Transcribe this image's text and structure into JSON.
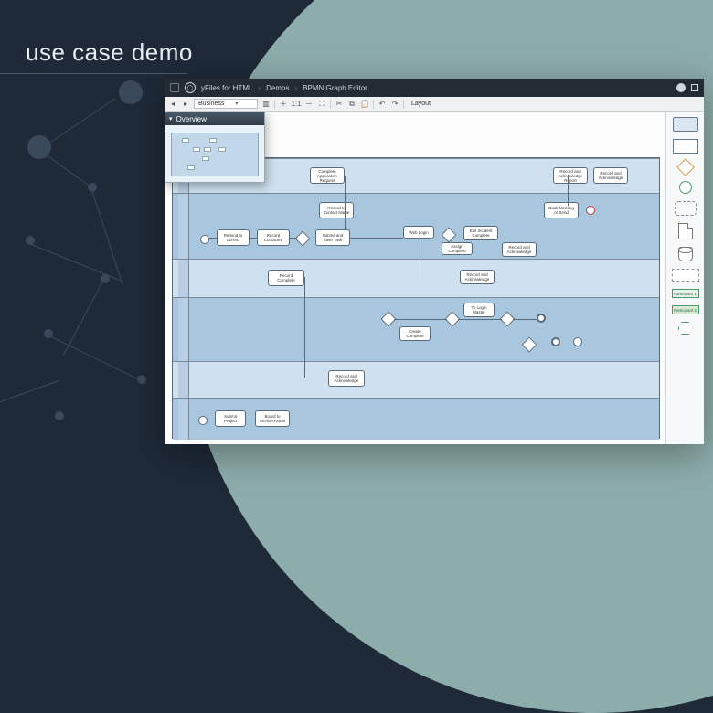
{
  "hero": {
    "title": "use case demo"
  },
  "titlebar": {
    "product": "yFiles for HTML",
    "crumb1": "Demos",
    "crumb2": "BPMN Graph Editor"
  },
  "toolbar": {
    "file_select": "Business",
    "layout_label": "Layout"
  },
  "overview": {
    "title": "Overview"
  },
  "palette": {
    "participant1": "Participant 1",
    "participant2": "Participant 2"
  },
  "tasks": {
    "t1": "Complete Application Request",
    "t2": "Record and Acknowledge Report",
    "t3": "Record and Acknowledge",
    "t4": "Book Meeting or Send",
    "t5": "Record to Contact Name",
    "t6": "Remind to Correct",
    "t7": "Record Contacted",
    "t8": "Submit and Save Task",
    "t9": "Web Login",
    "t10": "Edit Incident Complete",
    "t11": "Assign Complete",
    "t12": "Record and Acknowledge",
    "t13": "Record and Acknowledge",
    "t14": "Record Complete",
    "t15": "Create Complete",
    "t16": "To Login Master",
    "t17": "Record and Acknowledge",
    "t18": "Submit Project",
    "t19": "Board to Archive Action"
  }
}
